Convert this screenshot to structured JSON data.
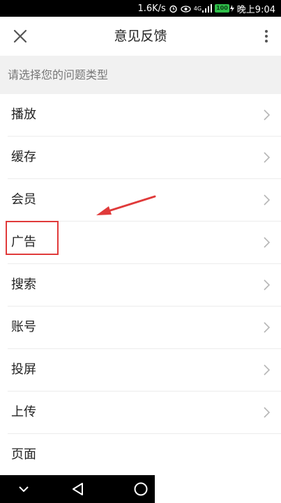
{
  "status_bar": {
    "net_speed": "1.6K/s",
    "signal": "4G",
    "battery": "100",
    "time": "晚上9:04"
  },
  "header": {
    "title": "意见反馈",
    "close_icon": "close-icon",
    "more_icon": "more-vert-icon"
  },
  "section": {
    "prompt": "请选择您的问题类型"
  },
  "items": [
    {
      "label": "播放",
      "has_chevron": true
    },
    {
      "label": "缓存",
      "has_chevron": true
    },
    {
      "label": "会员",
      "has_chevron": true
    },
    {
      "label": "广告",
      "has_chevron": true
    },
    {
      "label": "搜索",
      "has_chevron": true
    },
    {
      "label": "账号",
      "has_chevron": true
    },
    {
      "label": "投屏",
      "has_chevron": true
    },
    {
      "label": "上传",
      "has_chevron": true
    },
    {
      "label": "页面",
      "has_chevron": false
    }
  ],
  "annotation": {
    "highlight_color": "#e03a3a",
    "highlighted_item": "广告"
  },
  "nav_bar": {
    "icons": [
      "chevron-down-icon",
      "back-triangle-icon",
      "home-circle-icon"
    ]
  }
}
